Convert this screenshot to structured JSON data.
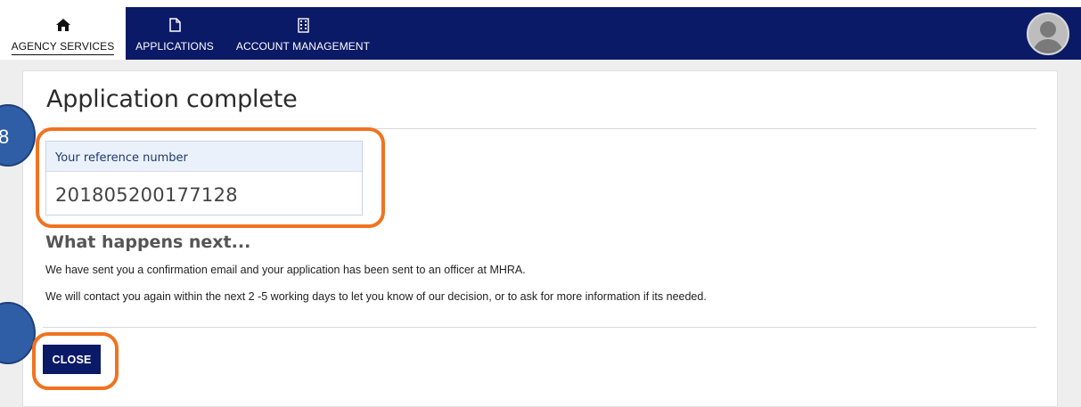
{
  "nav": {
    "items": [
      {
        "label": "AGENCY SERVICES",
        "icon": "home-icon",
        "active": true
      },
      {
        "label": "APPLICATIONS",
        "icon": "document-icon",
        "active": false
      },
      {
        "label": "ACCOUNT MANAGEMENT",
        "icon": "building-icon",
        "active": false
      }
    ],
    "avatar": "user-avatar-icon"
  },
  "page": {
    "title": "Application complete",
    "reference": {
      "label": "Your reference number",
      "number": "201805200177128"
    },
    "next": {
      "heading": "What happens next...",
      "paragraphs": [
        "We have sent you a confirmation email and your application has been sent to an officer at MHRA.",
        "We will contact you again within the next 2 -5 working days to let you know of our decision, or to ask for more information if its needed."
      ]
    },
    "close_label": "CLOSE"
  },
  "annotations": {
    "step_a": "8",
    "step_b": ""
  },
  "colors": {
    "nav_blue": "#0b1a66",
    "callout_orange": "#f07320",
    "step_circle_blue": "#2f5ea6",
    "ref_header_bg": "#eaf1fb"
  }
}
